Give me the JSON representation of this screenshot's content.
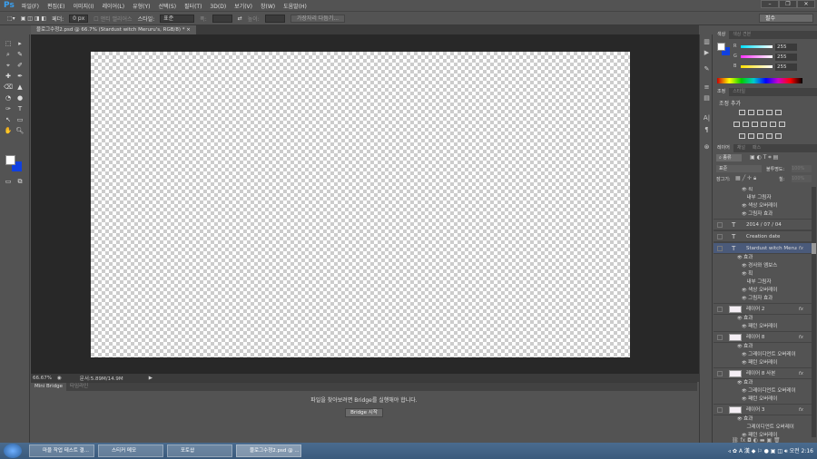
{
  "app": {
    "logo": "Ps",
    "menus": [
      "파일(F)",
      "편집(E)",
      "이미지(I)",
      "레이어(L)",
      "유형(Y)",
      "선택(S)",
      "필터(T)",
      "3D(D)",
      "보기(V)",
      "창(W)",
      "도움말(H)"
    ],
    "window": {
      "min": "–",
      "restore": "❐",
      "close": "✕"
    }
  },
  "options": {
    "feather_label": "페더:",
    "feather_value": "0 px",
    "antialias": "앤티 앨리어스",
    "style_label": "스타일:",
    "style_value": "표준",
    "width_label": "폭:",
    "height_label": "높이:",
    "refine": "가장자리 다듬기...",
    "workspace": "필수"
  },
  "document": {
    "tab": "블로그수정2.psd @ 66.7% (Stardust witch Meruru's, RGB/8) *",
    "close": "×"
  },
  "status": {
    "zoom": "66.67%",
    "doc": "문서:5.89M/14.9M"
  },
  "bridge": {
    "tabs": [
      "Mini Bridge",
      "타임라인"
    ],
    "message": "파일을 찾아보려면 Bridge를 실행해야 합니다.",
    "button": "Bridge 시작"
  },
  "color_panel": {
    "tabs": [
      "색상",
      "색상 견본"
    ],
    "channels": [
      {
        "label": "R",
        "value": "255",
        "color": "#00e0ff"
      },
      {
        "label": "G",
        "value": "255",
        "color": "#ff30ff"
      },
      {
        "label": "B",
        "value": "255",
        "color": "#ffe000"
      }
    ],
    "foreground": "#ffffff",
    "background": "#1040e0"
  },
  "adjust_panel": {
    "tabs": [
      "조정",
      "스타일"
    ],
    "title": "조정 추가"
  },
  "layers_panel": {
    "tabs": [
      "레이어",
      "채널",
      "패스"
    ],
    "kind": "종류",
    "blend": "표준",
    "opacity_label": "불투명도:",
    "opacity": "100%",
    "lock_label": "잠그기:",
    "fill_label": "칠:",
    "fill": "100%",
    "rows": [
      {
        "type": "sub",
        "text": "획",
        "eye": true
      },
      {
        "type": "sub",
        "text": "내부 그림자",
        "eye": false
      },
      {
        "type": "sub",
        "text": "색상 오버레이",
        "eye": true
      },
      {
        "type": "sub",
        "text": "그림자 효과",
        "eye": true
      },
      {
        "type": "text",
        "name": "2014 / 07 / 04"
      },
      {
        "type": "text",
        "name": "Creation date"
      },
      {
        "type": "text",
        "name": "Stardust witch Meruru's",
        "fx": true,
        "selected": true
      },
      {
        "type": "effects",
        "text": "효과"
      },
      {
        "type": "sub",
        "text": "경사와 엠보스",
        "eye": true
      },
      {
        "type": "sub",
        "text": "획",
        "eye": true
      },
      {
        "type": "sub",
        "text": "내부 그림자",
        "eye": false
      },
      {
        "type": "sub",
        "text": "색상 오버레이",
        "eye": true
      },
      {
        "type": "sub",
        "text": "그림자 효과",
        "eye": true
      },
      {
        "type": "layer",
        "name": "레이어 2",
        "fx": true
      },
      {
        "type": "effects",
        "text": "효과"
      },
      {
        "type": "sub",
        "text": "패턴 오버레이",
        "eye": true
      },
      {
        "type": "layer",
        "name": "레이어 8",
        "fx": true
      },
      {
        "type": "effects",
        "text": "효과"
      },
      {
        "type": "sub",
        "text": "그레이디언트 오버레이",
        "eye": true
      },
      {
        "type": "sub",
        "text": "패턴 오버레이",
        "eye": true
      },
      {
        "type": "layer",
        "name": "레이어 8 사본",
        "fx": true
      },
      {
        "type": "effects",
        "text": "효과"
      },
      {
        "type": "sub",
        "text": "그레이디언트 오버레이",
        "eye": true
      },
      {
        "type": "sub",
        "text": "패턴 오버레이",
        "eye": true
      },
      {
        "type": "layer",
        "name": "레이어 3",
        "fx": true
      },
      {
        "type": "effects",
        "text": "효과"
      },
      {
        "type": "sub",
        "text": "그레이디언트 오버레이",
        "eye": false
      },
      {
        "type": "sub",
        "text": "패턴 오버레이",
        "eye": true
      }
    ]
  },
  "taskbar": {
    "items": [
      "마을 작업 테스트 결...",
      "스티커 메모",
      "포토샵",
      "블로그수정2.psd @ ..."
    ],
    "clock": "오전 2:16"
  }
}
